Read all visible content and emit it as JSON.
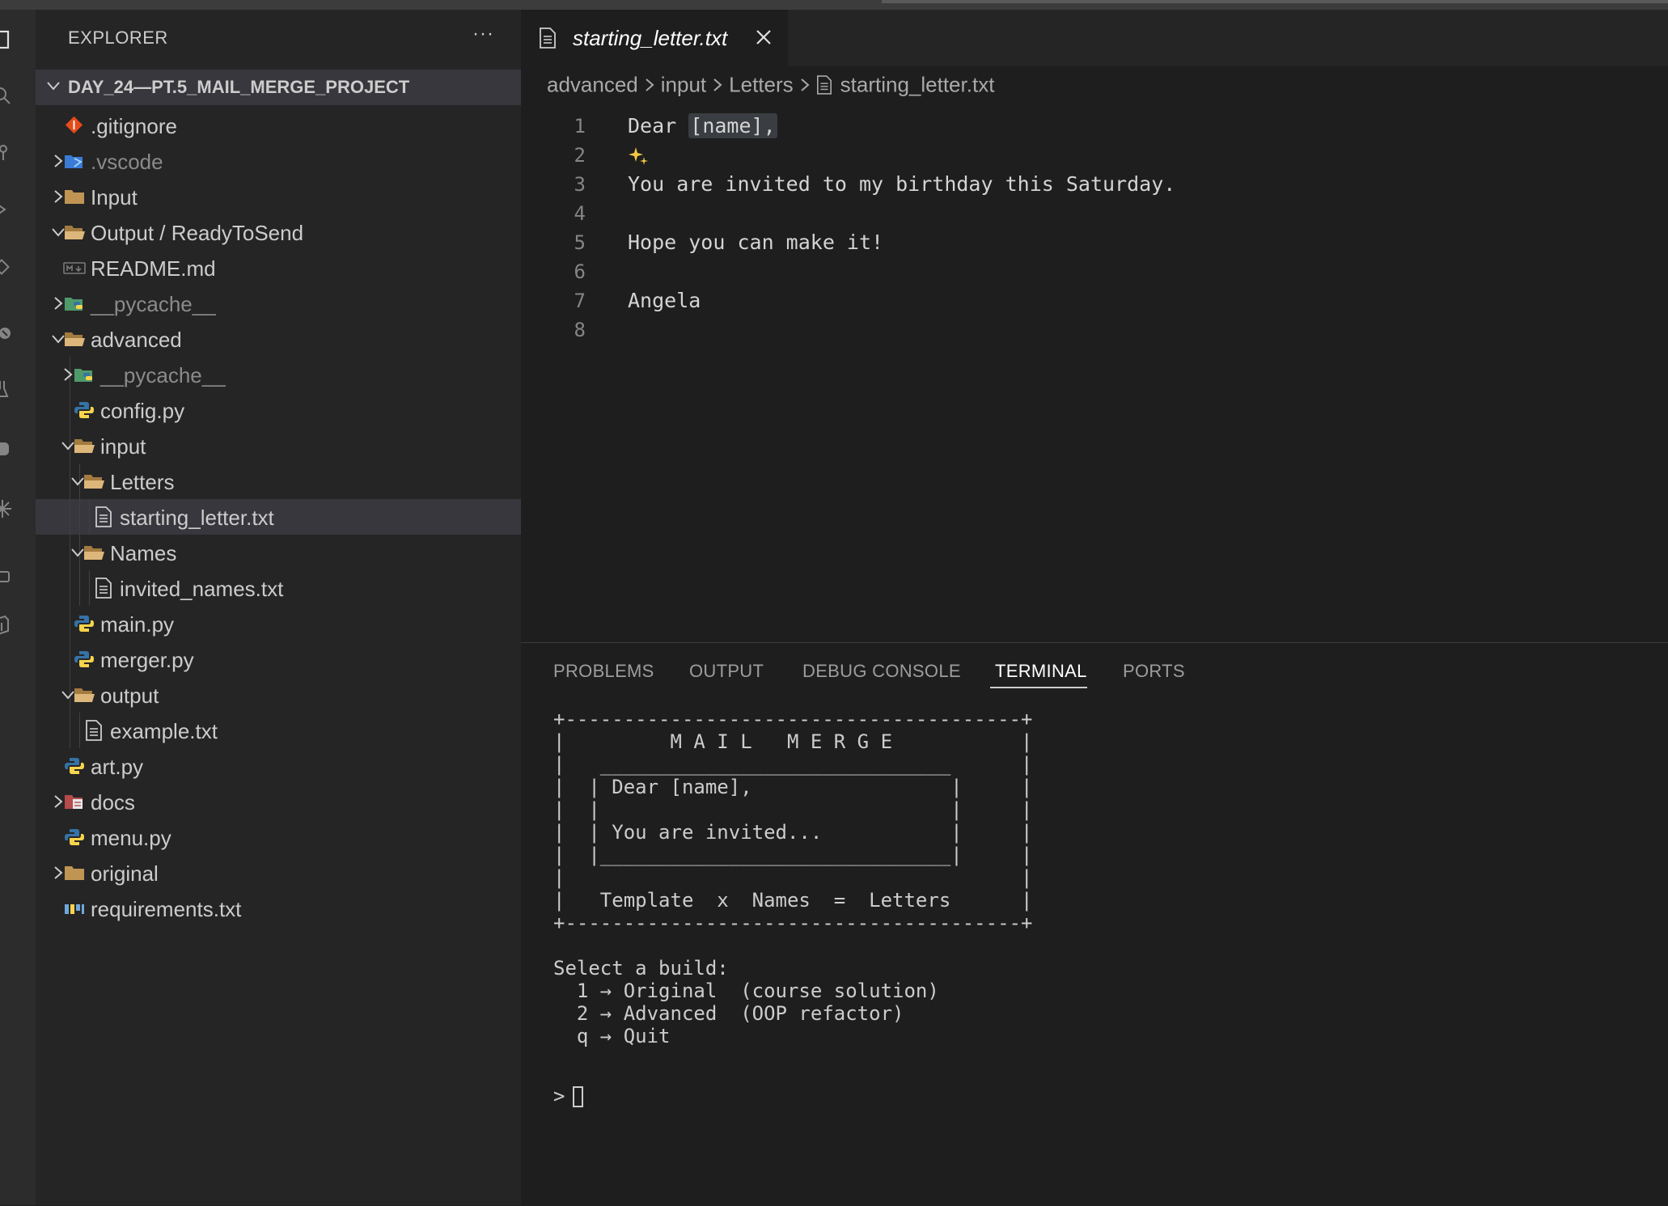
{
  "sidebar": {
    "title": "EXPLORER",
    "more": "···",
    "project": "DAY_24—PT.5_MAIL_MERGE_PROJECT"
  },
  "tree": [
    {
      "label": ".gitignore",
      "icon": "git-icon",
      "depth": 0,
      "chevron": "none",
      "dim": false
    },
    {
      "label": ".vscode",
      "icon": "vscode-folder-icon",
      "depth": 0,
      "chevron": "right",
      "dim": true
    },
    {
      "label": "Input",
      "icon": "folder-icon",
      "depth": 0,
      "chevron": "right",
      "dim": false
    },
    {
      "label": "Output / ReadyToSend",
      "icon": "folder-open-icon",
      "depth": 0,
      "chevron": "down",
      "dim": false
    },
    {
      "label": "README.md",
      "icon": "markdown-icon",
      "depth": 0,
      "chevron": "none",
      "dim": false
    },
    {
      "label": "__pycache__",
      "icon": "python-folder-icon",
      "depth": 0,
      "chevron": "right",
      "dim": true
    },
    {
      "label": "advanced",
      "icon": "folder-open-icon",
      "depth": 0,
      "chevron": "down",
      "dim": false
    },
    {
      "label": "__pycache__",
      "icon": "python-folder-icon",
      "depth": 1,
      "chevron": "right",
      "dim": true
    },
    {
      "label": "config.py",
      "icon": "python-icon",
      "depth": 1,
      "chevron": "none",
      "dim": false
    },
    {
      "label": "input",
      "icon": "folder-open-icon",
      "depth": 1,
      "chevron": "down",
      "dim": false
    },
    {
      "label": "Letters",
      "icon": "folder-open-icon",
      "depth": 2,
      "chevron": "down",
      "dim": false
    },
    {
      "label": "starting_letter.txt",
      "icon": "text-file-icon",
      "depth": 3,
      "chevron": "none",
      "dim": false,
      "selected": true
    },
    {
      "label": "Names",
      "icon": "folder-open-icon",
      "depth": 2,
      "chevron": "down",
      "dim": false
    },
    {
      "label": "invited_names.txt",
      "icon": "text-file-icon",
      "depth": 3,
      "chevron": "none",
      "dim": false
    },
    {
      "label": "main.py",
      "icon": "python-icon",
      "depth": 1,
      "chevron": "none",
      "dim": false
    },
    {
      "label": "merger.py",
      "icon": "python-icon",
      "depth": 1,
      "chevron": "none",
      "dim": false
    },
    {
      "label": "output",
      "icon": "folder-open-icon",
      "depth": 1,
      "chevron": "down",
      "dim": false
    },
    {
      "label": "example.txt",
      "icon": "text-file-icon",
      "depth": 2,
      "chevron": "none",
      "dim": false
    },
    {
      "label": "art.py",
      "icon": "python-icon",
      "depth": 0,
      "chevron": "none",
      "dim": false
    },
    {
      "label": "docs",
      "icon": "docs-folder-icon",
      "depth": 0,
      "chevron": "right",
      "dim": false
    },
    {
      "label": "menu.py",
      "icon": "python-icon",
      "depth": 0,
      "chevron": "none",
      "dim": false
    },
    {
      "label": "original",
      "icon": "folder-icon",
      "depth": 0,
      "chevron": "right",
      "dim": false
    },
    {
      "label": "requirements.txt",
      "icon": "requirements-icon",
      "depth": 0,
      "chevron": "none",
      "dim": false
    }
  ],
  "editor": {
    "tab_label": "starting_letter.txt",
    "breadcrumb": [
      "advanced",
      "input",
      "Letters",
      "starting_letter.txt"
    ],
    "lines": [
      {
        "num": "1",
        "text": "Dear ",
        "highlight": "[name],"
      },
      {
        "num": "2",
        "text": "",
        "sparkle": true
      },
      {
        "num": "3",
        "text": "You are invited to my birthday this Saturday."
      },
      {
        "num": "4",
        "text": ""
      },
      {
        "num": "5",
        "text": "Hope you can make it!"
      },
      {
        "num": "6",
        "text": ""
      },
      {
        "num": "7",
        "text": "Angela"
      },
      {
        "num": "8",
        "text": ""
      }
    ]
  },
  "panel": {
    "tabs": [
      "PROBLEMS",
      "OUTPUT",
      "DEBUG CONSOLE",
      "TERMINAL",
      "PORTS"
    ],
    "active_tab": "TERMINAL",
    "terminal_lines": [
      "+---------------------------------------+",
      "|         M A I L   M E R G E           |",
      "|   ______________________________      |",
      "|  | Dear [name],                 |     |",
      "|  |                              |     |",
      "|  | You are invited...           |     |",
      "|  |______________________________|     |",
      "|                                       |",
      "|   Template  x  Names  =  Letters      |",
      "+---------------------------------------+",
      "",
      "Select a build:",
      "  1 → Original  (course solution)",
      "  2 → Advanced  (OOP refactor)",
      "  q → Quit"
    ],
    "prompt": ">"
  }
}
